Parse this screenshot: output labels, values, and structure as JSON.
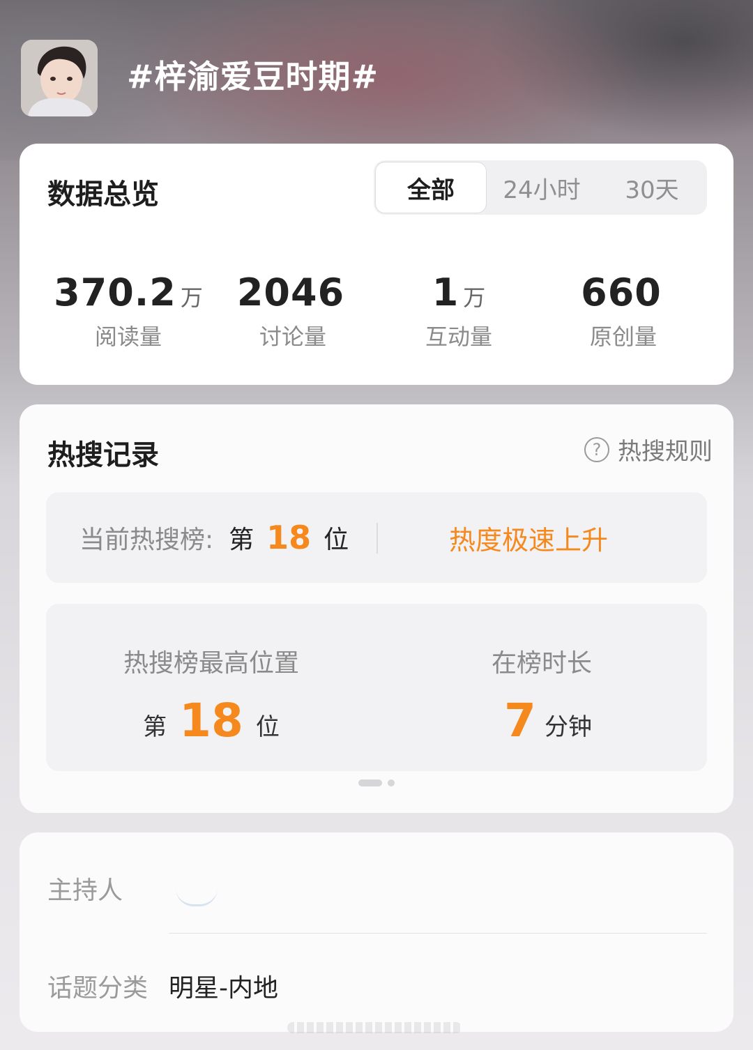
{
  "header": {
    "topic_title": "#梓渝爱豆时期#"
  },
  "overview": {
    "title": "数据总览",
    "tabs": [
      {
        "label": "全部",
        "active": true
      },
      {
        "label": "24小时",
        "active": false
      },
      {
        "label": "30天",
        "active": false
      }
    ],
    "stats": [
      {
        "value": "370.2",
        "unit": "万",
        "label": "阅读量"
      },
      {
        "value": "2046",
        "unit": "",
        "label": "讨论量"
      },
      {
        "value": "1",
        "unit": "万",
        "label": "互动量"
      },
      {
        "value": "660",
        "unit": "",
        "label": "原创量"
      }
    ]
  },
  "hot_search": {
    "title": "热搜记录",
    "rules_label": "热搜规则",
    "rules_icon": "question-circle-icon",
    "current": {
      "label": "当前热搜榜:",
      "prefix": "第",
      "rank": "18",
      "suffix": "位",
      "trend": "热度极速上升"
    },
    "best": {
      "label": "热搜榜最高位置",
      "prefix": "第",
      "rank": "18",
      "suffix": "位"
    },
    "duration": {
      "label": "在榜时长",
      "value": "7",
      "unit": "分钟"
    },
    "pager": {
      "pages": 2,
      "current": 1
    }
  },
  "info": {
    "host_label": "主持人",
    "category_label": "话题分类",
    "category_value": "明星-内地"
  },
  "colors": {
    "accent": "#f5891e",
    "title_text": "#ffffff"
  }
}
